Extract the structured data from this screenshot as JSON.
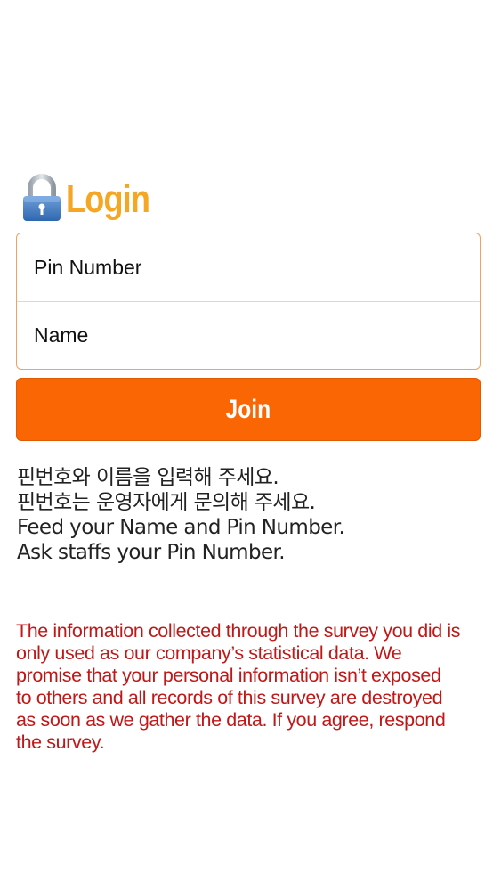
{
  "header": {
    "icon": "lock-icon",
    "title": "Login",
    "title_color": "#f5a623"
  },
  "form": {
    "pin_placeholder": "Pin Number",
    "name_placeholder": "Name",
    "border_color": "#f0a35c"
  },
  "join_button": {
    "label": "Join",
    "color": "#fa6603"
  },
  "instructions": {
    "line1": "핀번호와 이름을 입력해 주세요.",
    "line2": "핀번호는 운영자에게 문의해 주세요.",
    "line3": "Feed your Name and Pin Number.",
    "line4": "Ask staffs your Pin Number."
  },
  "notice": {
    "text": "The information collected through the survey you did is only used as our company’s statistical data. We promise that your personal information isn’t exposed to others and all records of this survey are destroyed as soon as we gather the data. If you agree, respond the survey.",
    "color": "#c01818"
  }
}
